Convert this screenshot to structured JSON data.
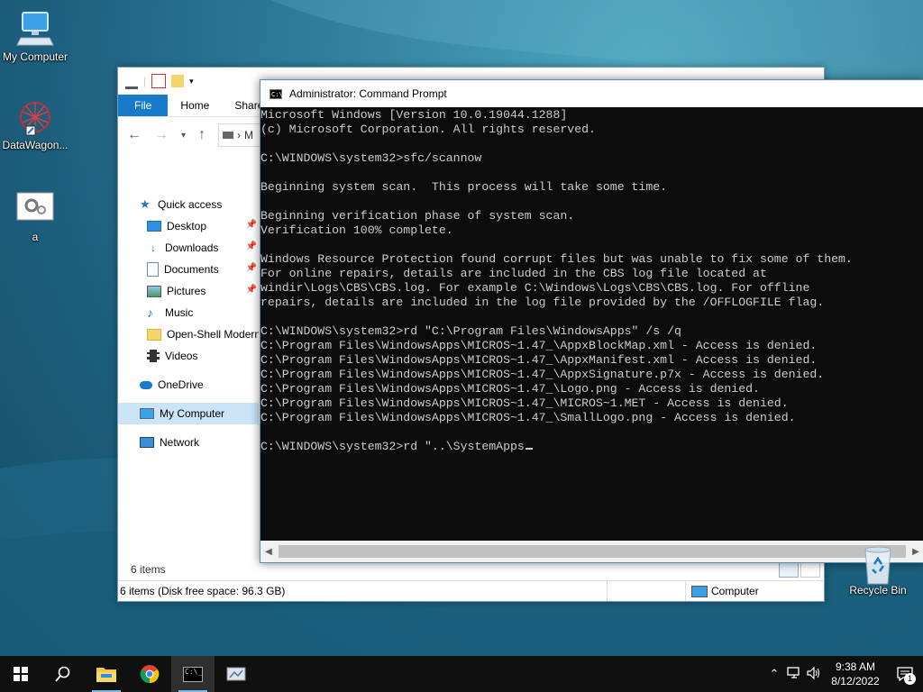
{
  "desktop": {
    "icons": [
      {
        "label": "My Computer",
        "icon": "monitor-icon"
      },
      {
        "label": "DataWagon...",
        "icon": "datawagon-icon"
      },
      {
        "label": "a",
        "icon": "gear-file-icon"
      },
      {
        "label": "Recycle Bin",
        "icon": "recycle-bin-icon"
      }
    ]
  },
  "explorer": {
    "ribbon_tabs": [
      "File",
      "Home",
      "Share"
    ],
    "address_path": "M",
    "nav": {
      "quick_access": "Quick access",
      "items": [
        {
          "label": "Desktop",
          "icon": "desktop-folder-icon",
          "pinned": true
        },
        {
          "label": "Downloads",
          "icon": "download-arrow-icon",
          "pinned": true
        },
        {
          "label": "Documents",
          "icon": "document-icon",
          "pinned": true
        },
        {
          "label": "Pictures",
          "icon": "pictures-icon",
          "pinned": true
        },
        {
          "label": "Music",
          "icon": "music-note-icon",
          "pinned": false
        },
        {
          "label": "Open-Shell Modern",
          "icon": "folder-icon",
          "pinned": false
        },
        {
          "label": "Videos",
          "icon": "film-icon",
          "pinned": false
        }
      ],
      "onedrive": "OneDrive",
      "my_computer": "My Computer",
      "network": "Network"
    },
    "items_count": "6 items",
    "status_left": "6 items (Disk free space: 96.3 GB)",
    "status_right": "Computer"
  },
  "cmd": {
    "title": "Administrator: Command Prompt",
    "lines": [
      "Microsoft Windows [Version 10.0.19044.1288]",
      "(c) Microsoft Corporation. All rights reserved.",
      "",
      "C:\\WINDOWS\\system32>sfc/scannow",
      "",
      "Beginning system scan.  This process will take some time.",
      "",
      "Beginning verification phase of system scan.",
      "Verification 100% complete.",
      "",
      "Windows Resource Protection found corrupt files but was unable to fix some of them.",
      "For online repairs, details are included in the CBS log file located at",
      "windir\\Logs\\CBS\\CBS.log. For example C:\\Windows\\Logs\\CBS\\CBS.log. For offline",
      "repairs, details are included in the log file provided by the /OFFLOGFILE flag.",
      "",
      "C:\\WINDOWS\\system32>rd \"C:\\Program Files\\WindowsApps\" /s /q",
      "C:\\Program Files\\WindowsApps\\MICROS~1.47_\\AppxBlockMap.xml - Access is denied.",
      "C:\\Program Files\\WindowsApps\\MICROS~1.47_\\AppxManifest.xml - Access is denied.",
      "C:\\Program Files\\WindowsApps\\MICROS~1.47_\\AppxSignature.p7x - Access is denied.",
      "C:\\Program Files\\WindowsApps\\MICROS~1.47_\\Logo.png - Access is denied.",
      "C:\\Program Files\\WindowsApps\\MICROS~1.47_\\MICROS~1.MET - Access is denied.",
      "C:\\Program Files\\WindowsApps\\MICROS~1.47_\\SmallLogo.png - Access is denied.",
      ""
    ],
    "prompt_line": "C:\\WINDOWS\\system32>rd \"..\\SystemApps"
  },
  "taskbar": {
    "apps": [
      "start-windows-icon",
      "search-icon",
      "file-explorer-icon",
      "chrome-icon",
      "command-prompt-icon",
      "server-manager-icon"
    ],
    "time": "9:38 AM",
    "date": "8/12/2022",
    "notification_count": "1"
  },
  "colors": {
    "file_tab": "#1979ca",
    "console_bg": "#0c0c0c",
    "console_text": "#cccccc",
    "taskbar": "#101010"
  }
}
